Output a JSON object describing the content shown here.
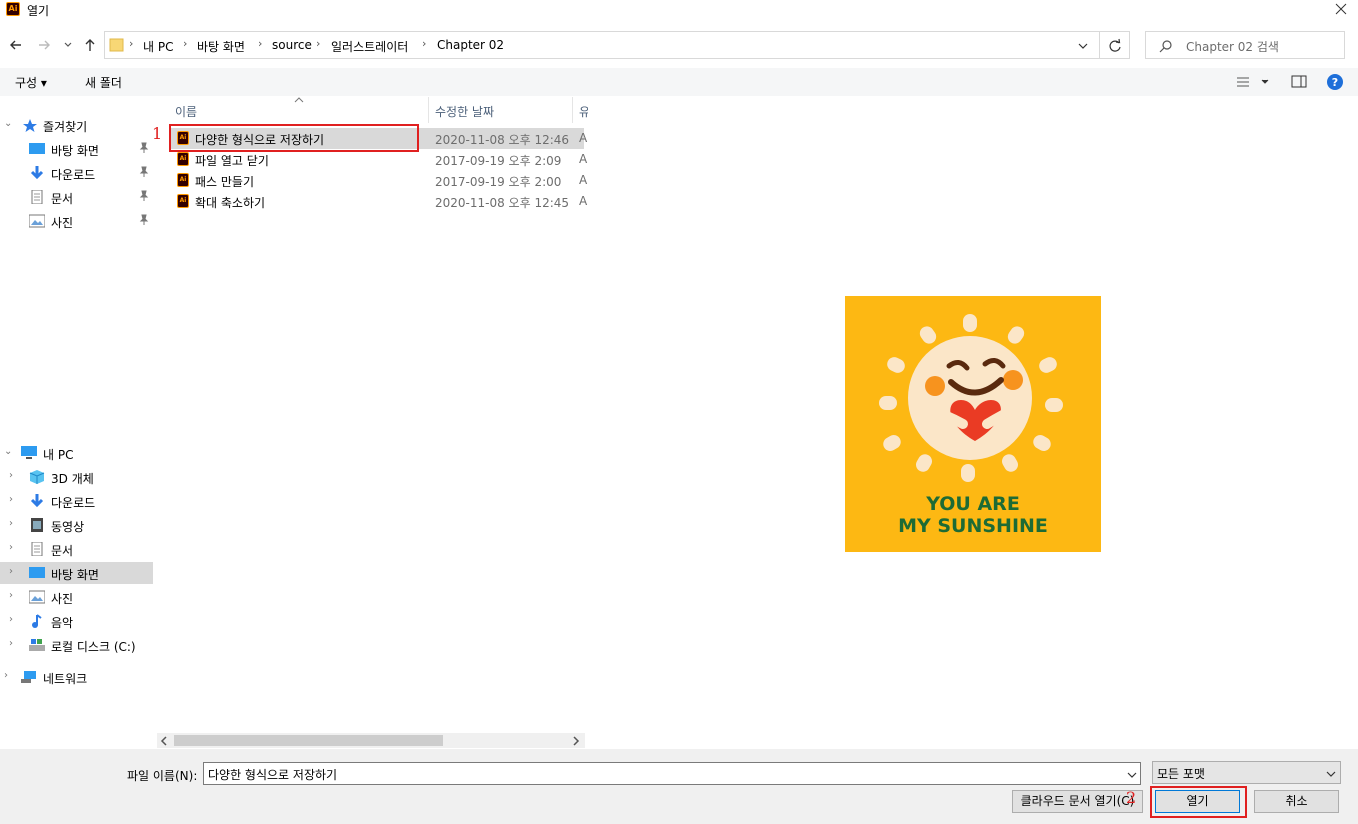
{
  "window": {
    "title": "열기",
    "app_icon_text": "Ai"
  },
  "address": {
    "crumbs": [
      "내 PC",
      "바탕 화면",
      "source",
      "일러스트레이터",
      "Chapter 02"
    ]
  },
  "search": {
    "placeholder": "Chapter 02 검색"
  },
  "toolbar": {
    "organize": "구성",
    "new_folder": "새 폴더"
  },
  "sidebar": {
    "quick_access": "즐겨찾기",
    "quick_items": [
      "바탕 화면",
      "다운로드",
      "문서",
      "사진"
    ],
    "this_pc": "내 PC",
    "pc_items": [
      "3D 개체",
      "다운로드",
      "동영상",
      "문서",
      "바탕 화면",
      "사진",
      "음악",
      "로컬 디스크 (C:)"
    ],
    "network": "네트워크"
  },
  "filelist": {
    "columns": {
      "name": "이름",
      "modified": "수정한 날짜",
      "type": "유"
    },
    "files": [
      {
        "name": "다양한 형식으로 저장하기",
        "modified": "2020-11-08 오후 12:46",
        "type": "A"
      },
      {
        "name": "파일 열고 닫기",
        "modified": "2017-09-19 오후 2:09",
        "type": "A"
      },
      {
        "name": "패스 만들기",
        "modified": "2017-09-19 오후 2:00",
        "type": "A"
      },
      {
        "name": "확대 축소하기",
        "modified": "2020-11-08 오후 12:45",
        "type": "A"
      }
    ]
  },
  "preview": {
    "line1": "YOU ARE",
    "line2": "MY SUNSHINE"
  },
  "bottom": {
    "filename_label": "파일 이름(N):",
    "filename_value": "다양한 형식으로 저장하기",
    "file_type": "모든 포맷",
    "cloud_button": "클라우드 문서 열기(C)",
    "open_button": "열기",
    "cancel_button": "취소"
  },
  "annotations": {
    "marker1": "1",
    "marker2": "2"
  },
  "colors": {
    "accent_red": "#e02020",
    "preview_bg": "#fdb813",
    "selection": "#d9d9d9"
  }
}
